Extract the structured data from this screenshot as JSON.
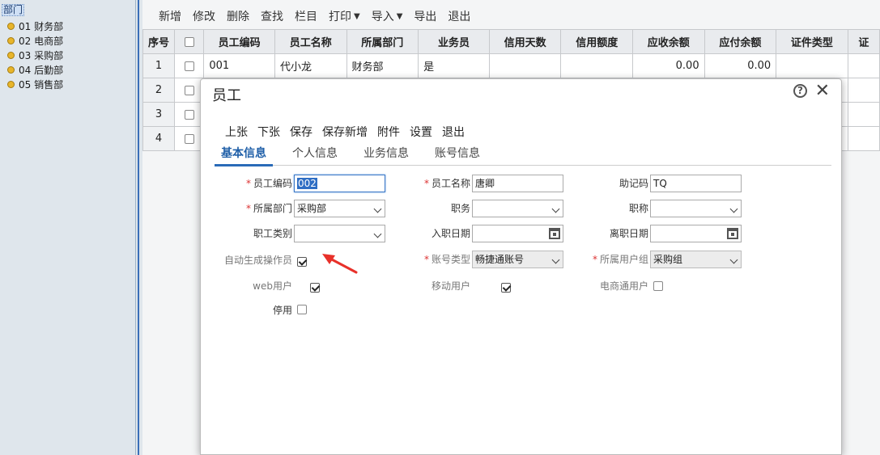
{
  "tree": {
    "root": "部门",
    "items": [
      "01 财务部",
      "02 电商部",
      "03 采购部",
      "04 后勤部",
      "05 销售部"
    ]
  },
  "toolbar": {
    "new": "新增",
    "edit": "修改",
    "delete": "删除",
    "find": "查找",
    "columns": "栏目",
    "print": "打印",
    "import": "导入",
    "export": "导出",
    "exit": "退出"
  },
  "grid": {
    "headers": [
      "序号",
      "",
      "员工编码",
      "员工名称",
      "所属部门",
      "业务员",
      "信用天数",
      "信用额度",
      "应收余额",
      "应付余额",
      "证件类型",
      "证"
    ],
    "rows": [
      {
        "idx": "1",
        "code": "001",
        "name": "代小龙",
        "dept": "财务部",
        "sales": "是",
        "days": "",
        "limit": "",
        "ar": "0.00",
        "ap": "0.00"
      },
      {
        "idx": "2"
      },
      {
        "idx": "3"
      },
      {
        "idx": "4"
      }
    ]
  },
  "modal": {
    "title": "员工",
    "toolbar": [
      "上张",
      "下张",
      "保存",
      "保存新增",
      "附件",
      "设置",
      "退出"
    ],
    "tabs": [
      "基本信息",
      "个人信息",
      "业务信息",
      "账号信息"
    ],
    "fields": {
      "code_label": "员工编码",
      "code_value": "002",
      "name_label": "员工名称",
      "name_value": "唐卿",
      "mnemonic_label": "助记码",
      "mnemonic_value": "TQ",
      "dept_label": "所属部门",
      "dept_value": "采购部",
      "duty_label": "职务",
      "duty_value": "",
      "title_label": "职称",
      "title_value": "",
      "category_label": "职工类别",
      "category_value": "",
      "hire_label": "入职日期",
      "hire_value": "",
      "leave_label": "离职日期",
      "leave_value": "",
      "auto_op_label": "自动生成操作员",
      "acct_type_label": "账号类型",
      "acct_type_value": "畅捷通账号",
      "user_group_label": "所属用户组",
      "user_group_value": "采购组",
      "web_label": "web用户",
      "mobile_label": "移动用户",
      "ecom_label": "电商通用户",
      "disabled_label": "停用"
    }
  }
}
